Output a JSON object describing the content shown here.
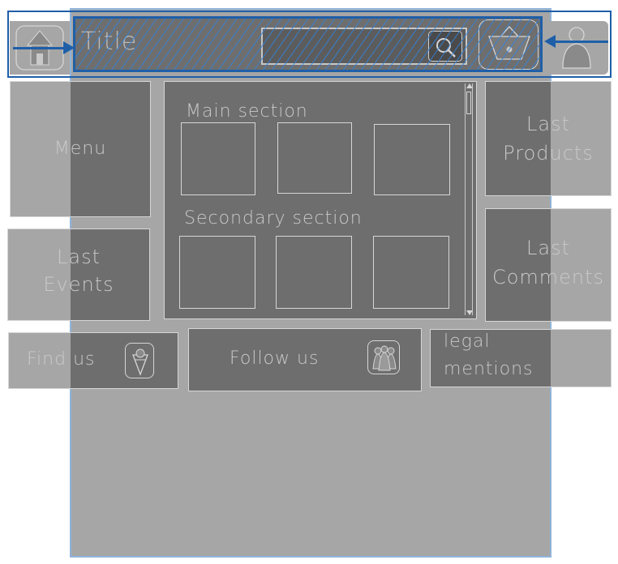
{
  "header": {
    "title": "Title",
    "search_placeholder": "",
    "icons": [
      "home-icon",
      "search-icon",
      "basket-icon",
      "user-icon"
    ]
  },
  "sidebar_left": {
    "menu_label": "Menu",
    "events_label_1": "Last",
    "events_label_2": "Events"
  },
  "main": {
    "main_section_label": "Main section",
    "secondary_section_label": "Secondary section",
    "main_tiles": 3,
    "secondary_tiles": 3
  },
  "sidebar_right": {
    "products_label_1": "Last",
    "products_label_2": "Products",
    "comments_label_1": "Last",
    "comments_label_2": "Comments"
  },
  "footer": {
    "find_us_label": "Find us",
    "follow_us_label": "Follow us",
    "legal_label_1": "legal",
    "legal_label_2": "mentions"
  },
  "colors": {
    "annotation_blue": "#1f5fa8",
    "panel_dark": "#6e6e6e",
    "panel_light": "#a6a6a6",
    "sketch_line": "#d6d6d6"
  }
}
